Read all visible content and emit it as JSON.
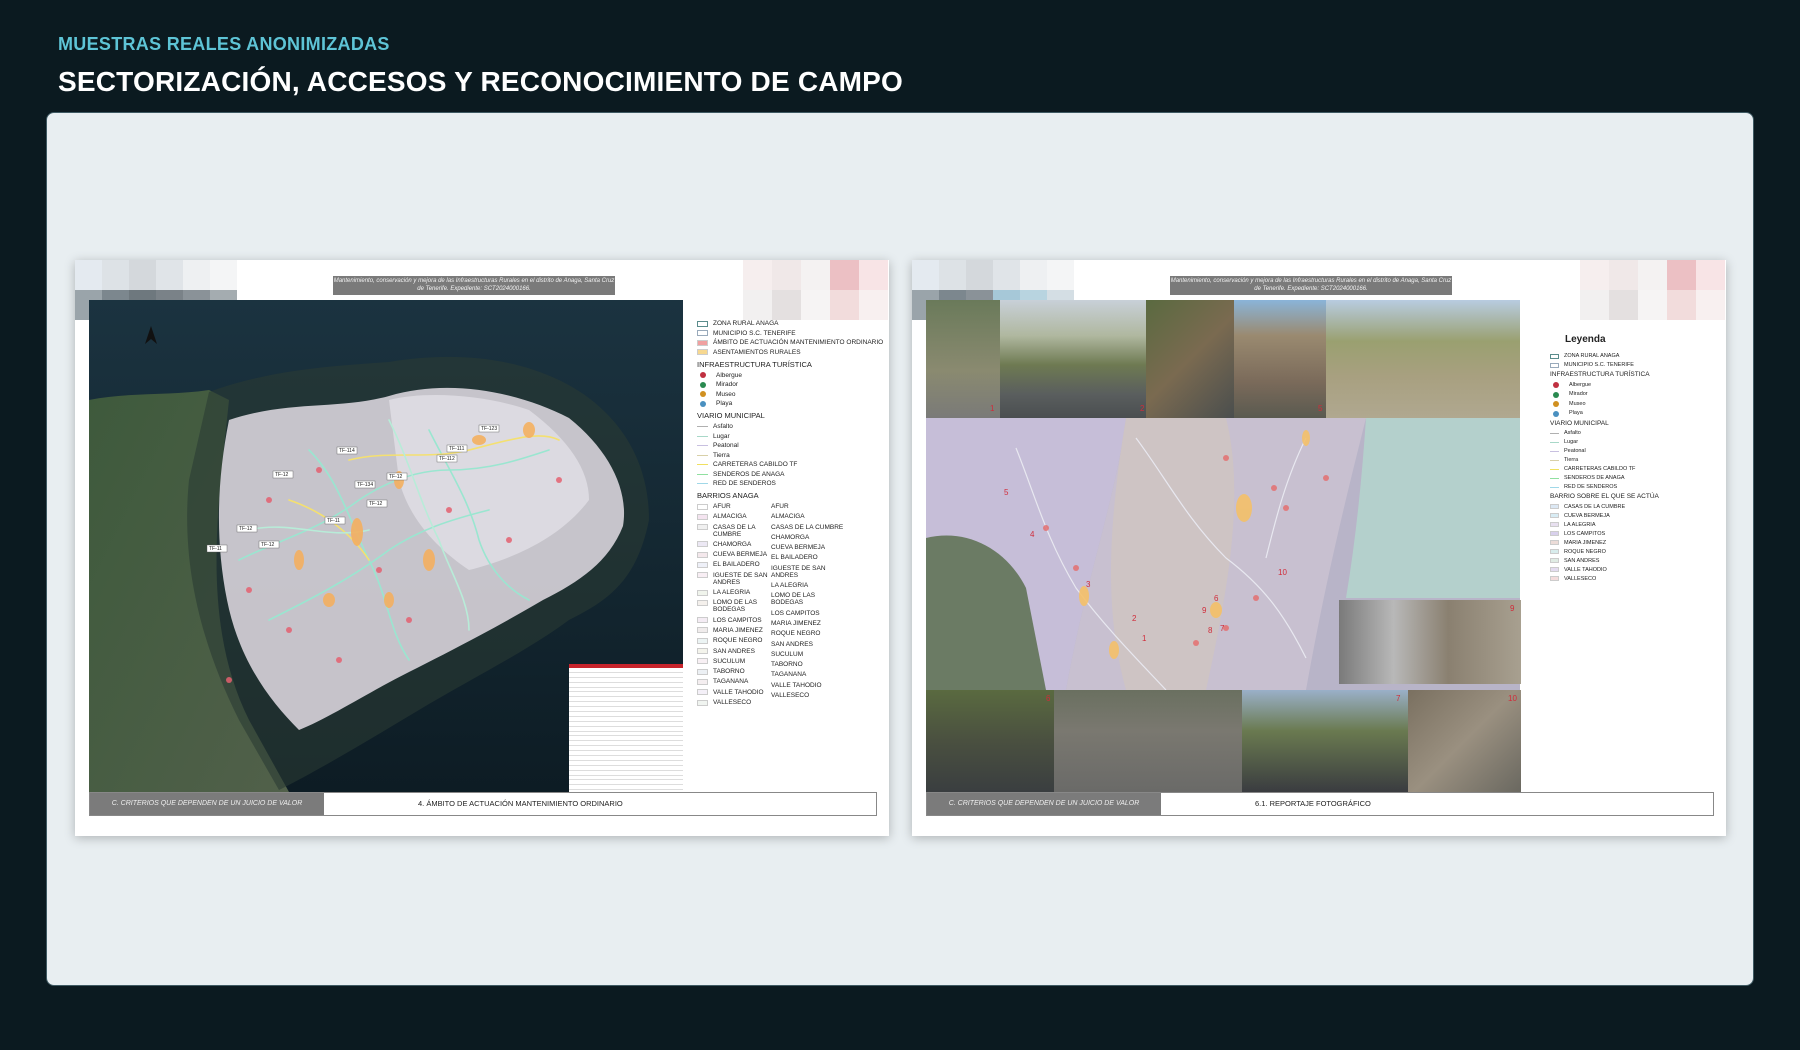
{
  "header": {
    "eyebrow": "MUESTRAS REALES ANONIMIZADAS",
    "title": "SECTORIZACIÓN, ACCESOS Y RECONOCIMIENTO DE CAMPO"
  },
  "pages": [
    {
      "doc_header": "Mantenimiento, conservación y mejora de las Infraestructuras Rurales en el distrito de Anaga, Santa Cruz de Tenerife. Expediente: SCT2024000166.",
      "footer_left": "C. CRITERIOS QUE DEPENDEN DE UN JUICIO DE VALOR",
      "footer_right": "4. ÁMBITO DE ACTUACIÓN MANTENIMIENTO ORDINARIO",
      "road_labels": [
        "TF-11",
        "TF-12",
        "TF-12",
        "TF-11",
        "TF-12",
        "TF-12",
        "TF-114",
        "TF-134",
        "TF-112",
        "TF-111",
        "TF-123",
        "TF-12"
      ],
      "legend": {
        "items": [
          {
            "label": "ZONA RURAL ANAGA",
            "color": "#ffffff",
            "border": "#5a8c8c"
          },
          {
            "label": "MUNICIPIO S.C. TENERIFE",
            "color": "#ffffff",
            "border": "#9ab"
          },
          {
            "label": "ÁMBITO DE ACTUACIÓN MANTENIMIENTO ORDINARIO",
            "color": "#f0a0a0"
          },
          {
            "label": "ASENTAMIENTOS RURALES",
            "color": "#f7d890"
          }
        ],
        "infra_heading": "INFRAESTRUCTURA TURÍSTICA",
        "infra": [
          {
            "label": "Albergue",
            "icon": "hostel-icon",
            "color": "#c03040"
          },
          {
            "label": "Mirador",
            "icon": "viewpoint-icon",
            "color": "#2a8a50"
          },
          {
            "label": "Museo",
            "icon": "museum-icon",
            "color": "#d09020"
          },
          {
            "label": "Playa",
            "icon": "beach-icon",
            "color": "#4a90c0"
          }
        ],
        "viario_heading": "VIARIO MUNICIPAL",
        "viario": [
          {
            "label": "Asfalto",
            "color": "#b0b0b0"
          },
          {
            "label": "Lugar",
            "color": "#a8d8c8"
          },
          {
            "label": "Peatonal",
            "color": "#c8c0e0"
          },
          {
            "label": "Tierra",
            "color": "#d8d0a8"
          },
          {
            "label": "CARRETERAS CABILDO TF",
            "color": "#f0e060"
          },
          {
            "label": "SENDEROS DE ANAGA",
            "color": "#90e0a0"
          },
          {
            "label": "RED DE SENDEROS",
            "color": "#a0d8e8"
          }
        ],
        "barrios_heading": "BARRIOS ANAGA",
        "barrios": [
          {
            "label": "AFUR",
            "color": "#ffffff"
          },
          {
            "label": "ALMACIGA",
            "color": "#f4e4f0"
          },
          {
            "label": "CASAS DE LA CUMBRE",
            "color": "#f0f0f0"
          },
          {
            "label": "CHAMORGA",
            "color": "#ece8f4"
          },
          {
            "label": "CUEVA BERMEJA",
            "color": "#f4e8ec"
          },
          {
            "label": "EL BAILADERO",
            "color": "#eef0f8"
          },
          {
            "label": "IGUESTE DE SAN ANDRES",
            "color": "#f8eef4"
          },
          {
            "label": "LA ALEGRIA",
            "color": "#f0f4ec"
          },
          {
            "label": "LOMO DE LAS BODEGAS",
            "color": "#f4f0ec"
          },
          {
            "label": "LOS CAMPITOS",
            "color": "#f4ecf4"
          },
          {
            "label": "MARIA JIMENEZ",
            "color": "#f0ecec"
          },
          {
            "label": "ROQUE NEGRO",
            "color": "#ecf4f4"
          },
          {
            "label": "SAN ANDRES",
            "color": "#f4f4ec"
          },
          {
            "label": "SUCULUM",
            "color": "#f8f0f4"
          },
          {
            "label": "TABORNO",
            "color": "#ecf0f4"
          },
          {
            "label": "TAGANANA",
            "color": "#f4eef0"
          },
          {
            "label": "VALLE TAHODIO",
            "color": "#f4f0f8"
          },
          {
            "label": "VALLESECO",
            "color": "#f0f4f0"
          }
        ]
      }
    },
    {
      "doc_header": "Mantenimiento, conservación y mejora de las Infraestructuras Rurales en el distrito de Anaga, Santa Cruz de Tenerife. Expediente: SCT2024000166.",
      "footer_left": "C. CRITERIOS QUE DEPENDEN DE UN JUICIO DE VALOR",
      "footer_right": "6.1. REPORTAJE FOTOGRÁFICO",
      "photo_numbers": [
        "1",
        "2",
        "3",
        "4",
        "5",
        "6",
        "7",
        "8",
        "9",
        "10"
      ],
      "map_numbers": [
        "1",
        "2",
        "3",
        "4",
        "5",
        "6",
        "7",
        "8",
        "9",
        "10"
      ],
      "legend": {
        "title": "Leyenda",
        "items": [
          {
            "label": "ZONA RURAL ANAGA",
            "color": "#ffffff",
            "border": "#5a8c8c"
          },
          {
            "label": "MUNICIPIO S.C. TENERIFE",
            "color": "#ffffff",
            "border": "#9ab"
          }
        ],
        "infra_heading": "INFRAESTRUCTURA TURÍSTICA",
        "infra": [
          {
            "label": "Albergue",
            "icon": "hostel-icon",
            "color": "#c03040"
          },
          {
            "label": "Mirador",
            "icon": "viewpoint-icon",
            "color": "#2a8a50"
          },
          {
            "label": "Museo",
            "icon": "museum-icon",
            "color": "#d09020"
          },
          {
            "label": "Playa",
            "icon": "beach-icon",
            "color": "#4a90c0"
          }
        ],
        "viario_heading": "VIARIO MUNICIPAL",
        "viario": [
          {
            "label": "Asfalto",
            "color": "#b0b0b0"
          },
          {
            "label": "Lugar",
            "color": "#a8d8c8"
          },
          {
            "label": "Peatonal",
            "color": "#c8c0e0"
          },
          {
            "label": "Tierra",
            "color": "#d8d0a8"
          },
          {
            "label": "CARRETERAS CABILDO TF",
            "color": "#f0e060"
          },
          {
            "label": "SENDEROS DE ANAGA",
            "color": "#90e0a0"
          },
          {
            "label": "RED DE SENDEROS",
            "color": "#a0d8e8"
          }
        ],
        "barrio_heading": "BARRIO SOBRE EL QUE SE ACTÚA",
        "barrios": [
          {
            "label": "CASAS DE LA CUMBRE",
            "color": "#dce8f4"
          },
          {
            "label": "CUEVA BERMEJA",
            "color": "#d8ecf4"
          },
          {
            "label": "LA ALEGRIA",
            "color": "#e8e0f0"
          },
          {
            "label": "LOS CAMPITOS",
            "color": "#d8d0ec"
          },
          {
            "label": "MARIA JIMENEZ",
            "color": "#ecdcd8"
          },
          {
            "label": "ROQUE NEGRO",
            "color": "#d8ecec"
          },
          {
            "label": "SAN ANDRES",
            "color": "#e0ece4"
          },
          {
            "label": "VALLE TAHODIO",
            "color": "#e4dcf0"
          },
          {
            "label": "VALLESECO",
            "color": "#f4dcdc"
          }
        ]
      }
    }
  ]
}
